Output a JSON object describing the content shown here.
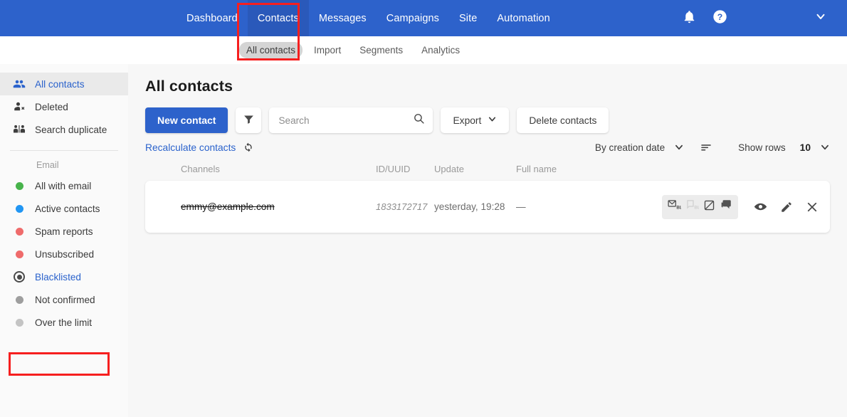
{
  "topnav": {
    "items": [
      {
        "label": "Dashboard",
        "active": false
      },
      {
        "label": "Contacts",
        "active": true
      },
      {
        "label": "Messages",
        "active": false
      },
      {
        "label": "Campaigns",
        "active": false
      },
      {
        "label": "Site",
        "active": false
      },
      {
        "label": "Automation",
        "active": false
      }
    ],
    "bg_color": "#2d62cb",
    "active_bg_color": "#2a59ba"
  },
  "subnav": {
    "items": [
      {
        "label": "All contacts",
        "active": true
      },
      {
        "label": "Import",
        "active": false
      },
      {
        "label": "Segments",
        "active": false
      },
      {
        "label": "Analytics",
        "active": false
      }
    ]
  },
  "sidebar": {
    "top_items": [
      {
        "label": "All contacts",
        "icon": "people-icon",
        "active": true
      },
      {
        "label": "Deleted",
        "icon": "person-remove-icon",
        "active": false
      },
      {
        "label": "Search duplicate",
        "icon": "duplicate-people-icon",
        "active": false
      }
    ],
    "group_label": "Email",
    "email_items": [
      {
        "label": "All with email",
        "dot_color": "#47b34b",
        "type": "dot"
      },
      {
        "label": "Active contacts",
        "dot_color": "#2196f3",
        "type": "dot"
      },
      {
        "label": "Spam reports",
        "dot_color": "#ef6b6b",
        "type": "dot"
      },
      {
        "label": "Unsubscribed",
        "dot_color": "#ef6b6b",
        "type": "dot"
      },
      {
        "label": "Blacklisted",
        "dot_color": "#4a4a4a",
        "type": "ring",
        "highlighted": true
      },
      {
        "label": "Not confirmed",
        "dot_color": "#9e9e9e",
        "type": "dot"
      },
      {
        "label": "Over the limit",
        "dot_color": "#c4c4c4",
        "type": "dot"
      }
    ]
  },
  "main": {
    "page_title": "All contacts",
    "new_contact_label": "New contact",
    "filter_icon": "funnel-filter-icon",
    "search_placeholder": "Search",
    "search_value": "",
    "export_label": "Export",
    "delete_contacts_label": "Delete contacts",
    "recalculate_label": "Recalculate contacts",
    "sort_label": "By creation date",
    "show_rows_label": "Show rows",
    "rows_count": "10"
  },
  "table": {
    "headers": {
      "channels": "Channels",
      "id_uuid": "ID/UUID",
      "update": "Update",
      "full_name": "Full name"
    },
    "rows": [
      {
        "channel": "emmy@example.com",
        "id_uuid": "1833172717",
        "update": "yesterday, 19:28",
        "full_name": "—",
        "channel_badges": [
          "email-blacklisted-icon",
          "sms-blacklisted-disabled-icon",
          "push-disabled-icon",
          "chat-icon"
        ],
        "actions": [
          "view-eye-icon",
          "edit-pencil-icon",
          "close-x-icon"
        ]
      }
    ]
  },
  "annotations": {
    "color": "#f61f1f",
    "boxes": [
      "contacts-nav-highlight",
      "blacklisted-sidebar-highlight"
    ]
  },
  "colors": {
    "primary_blue": "#2d62cb",
    "link_blue": "#2a62cc",
    "page_bg": "#f7f7f7",
    "sidebar_bg": "#fafafa"
  }
}
